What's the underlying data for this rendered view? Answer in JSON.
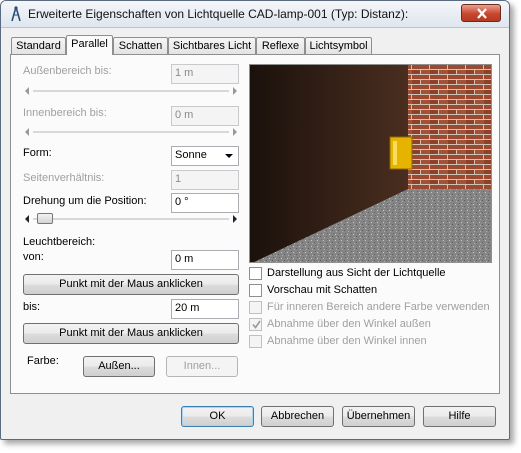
{
  "window": {
    "title": "Erweiterte Eigenschaften von Lichtquelle CAD-lamp-001 (Typ: Distanz):",
    "app_icon": "compass-icon",
    "close_icon": "close-icon"
  },
  "tabs": [
    {
      "label": "Standard",
      "active": false
    },
    {
      "label": "Parallel",
      "active": true
    },
    {
      "label": "Schatten",
      "active": false
    },
    {
      "label": "Sichtbares Licht",
      "active": false
    },
    {
      "label": "Reflexe",
      "active": false
    },
    {
      "label": "Lichtsymbol",
      "active": false
    }
  ],
  "form": {
    "aussenbereich": {
      "label": "Außenbereich bis:",
      "value": "1 m",
      "enabled": false
    },
    "innenbereich": {
      "label": "Innenbereich bis:",
      "value": "0 m",
      "enabled": false
    },
    "form": {
      "label": "Form:",
      "value": "Sonne"
    },
    "seitenverhaeltnis": {
      "label": "Seitenverhältnis:",
      "value": "1",
      "enabled": false
    },
    "drehung": {
      "label": "Drehung um die Position:",
      "value": "0 °"
    },
    "leuchtbereich": {
      "label": "Leuchtbereich:"
    },
    "von": {
      "label": "von:",
      "value": "0 m"
    },
    "pick_button_1": "Punkt mit der Maus anklicken",
    "bis": {
      "label": "bis:",
      "value": "20 m"
    },
    "pick_button_2": "Punkt mit der Maus anklicken",
    "farbe": {
      "label": "Farbe:",
      "aussen_button": "Außen...",
      "innen_button": "Innen..."
    }
  },
  "options": [
    {
      "label": "Darstellung aus Sicht der Lichtquelle",
      "checked": false,
      "enabled": true
    },
    {
      "label": "Vorschau mit Schatten",
      "checked": false,
      "enabled": true
    },
    {
      "label": "Für inneren Bereich andere Farbe verwenden",
      "checked": false,
      "enabled": false
    },
    {
      "label": "Abnahme über den Winkel außen",
      "checked": true,
      "enabled": false
    },
    {
      "label": "Abnahme über den Winkel innen",
      "checked": false,
      "enabled": false
    }
  ],
  "footer": {
    "ok": "OK",
    "cancel": "Abbrechen",
    "apply": "Übernehmen",
    "help": "Hilfe"
  },
  "colors": {
    "wall_dark": "#2e1d14",
    "brick": "#9b4a31",
    "mortar": "#cfc3b5",
    "lamp_yellow": "#e6b400",
    "floor": "#8b8b8b"
  }
}
